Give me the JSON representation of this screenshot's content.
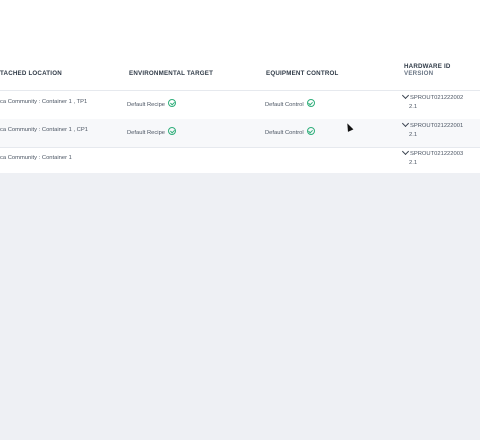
{
  "table": {
    "headers": {
      "attached_location": "TACHED LOCATION",
      "environmental_target": "ENVIRONMENTAL TARGET",
      "equipment_control": "EQUIPMENT CONTROL",
      "hardware_id": "HARDWARE ID",
      "version": "VERSION"
    },
    "rows": [
      {
        "location": "ca Community : Container 1 , TP1",
        "target": "Default Recipe",
        "control": "Default Control",
        "hardware_id": "SPROUT021222002",
        "version": "2.1"
      },
      {
        "location": "ca Community : Container 1 , CP1",
        "target": "Default Recipe",
        "control": "Default Control",
        "hardware_id": "SPROUT021222001",
        "version": "2.1"
      },
      {
        "location": "ca Community : Container 1",
        "target": "",
        "control": "",
        "hardware_id": "SPROUT021222003",
        "version": "2.1"
      }
    ]
  },
  "icons": {
    "status": "check-circle-icon",
    "expand": "chevron-down-icon"
  },
  "colors": {
    "background": "#eef0f4",
    "status_green": "#2fae7a"
  }
}
